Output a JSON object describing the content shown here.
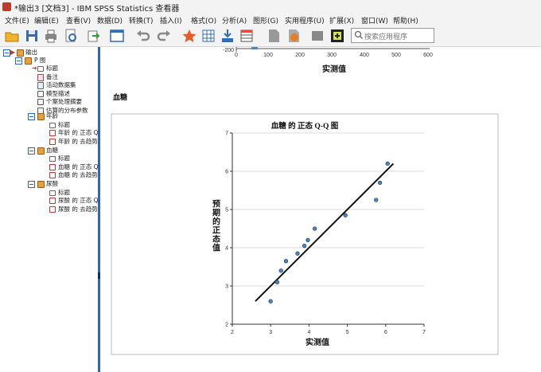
{
  "window": {
    "title": "*输出3 [文档3] - IBM SPSS Statistics 查看器"
  },
  "menu": [
    {
      "label": "文件(E)"
    },
    {
      "label": "编辑(E)"
    },
    {
      "label": "查看(V)"
    },
    {
      "label": "数据(D)"
    },
    {
      "label": "转换(T)"
    },
    {
      "label": "插入(I)"
    },
    {
      "label": "格式(O)"
    },
    {
      "label": "分析(A)"
    },
    {
      "label": "图形(G)"
    },
    {
      "label": "实用程序(U)"
    },
    {
      "label": "扩展(X)"
    },
    {
      "label": "窗口(W)"
    },
    {
      "label": "帮助(H)"
    }
  ],
  "toolbar": {
    "icons": [
      "open-icon",
      "save-icon",
      "print-icon",
      "print-preview-icon",
      "export-icon",
      "recall-dialog-icon",
      "undo-icon",
      "redo-icon",
      "goto-case-icon",
      "goto-variable-icon",
      "variables-icon",
      "insert-table-icon",
      "doc-icon",
      "chart-icon",
      "hidden-icon",
      "designated-window-icon"
    ],
    "search_placeholder": "搜索应用程序"
  },
  "tree": {
    "root": "输出",
    "pp": "P 图",
    "pp_children": [
      "标题",
      "备注",
      "活动数据集",
      "模型描述",
      "个案处理摘要",
      "估算的分布参数"
    ],
    "groups": [
      {
        "label": "年龄",
        "children": [
          "标题",
          "年龄 的 正态 Q",
          "年龄 的 去趋势"
        ]
      },
      {
        "label": "血糖",
        "children": [
          "标题",
          "血糖 的 正态 Q",
          "血糖 的 去趋势"
        ]
      },
      {
        "label": "尿酸",
        "children": [
          "标题",
          "尿酸 的 正态 Q",
          "尿酸 的 去趋势"
        ]
      }
    ]
  },
  "top_chart": {
    "ticks": [
      "-200",
      "0",
      "100",
      "200",
      "300",
      "400",
      "500",
      "600"
    ],
    "xlabel": "实测值"
  },
  "section_heading": "血糖",
  "chart_data": {
    "type": "scatter",
    "title": "血糖 的 正态 Q-Q 图",
    "xlabel": "实测值",
    "ylabel": "预期的正态值",
    "xlim": [
      2,
      7
    ],
    "ylim": [
      2,
      7
    ],
    "xticks": [
      "2",
      "3",
      "4",
      "5",
      "6",
      "7"
    ],
    "yticks": [
      "2",
      "3",
      "4",
      "5",
      "6",
      "7"
    ],
    "grid": "horizontal",
    "points": [
      {
        "x": 3.0,
        "y": 2.6
      },
      {
        "x": 3.17,
        "y": 3.1
      },
      {
        "x": 3.27,
        "y": 3.4
      },
      {
        "x": 3.4,
        "y": 3.65
      },
      {
        "x": 3.7,
        "y": 3.85
      },
      {
        "x": 3.88,
        "y": 4.05
      },
      {
        "x": 3.97,
        "y": 4.2
      },
      {
        "x": 4.15,
        "y": 4.5
      },
      {
        "x": 4.95,
        "y": 4.85
      },
      {
        "x": 5.75,
        "y": 5.25
      },
      {
        "x": 5.85,
        "y": 5.7
      },
      {
        "x": 6.05,
        "y": 6.2
      }
    ],
    "reference_line": [
      {
        "x": 2.6,
        "y": 2.6
      },
      {
        "x": 6.2,
        "y": 6.2
      }
    ],
    "colors": {
      "point_fill": "#4a86c5",
      "point_stroke": "#1f3f66",
      "line": "#111111",
      "grid": "#cfcfcf"
    }
  }
}
